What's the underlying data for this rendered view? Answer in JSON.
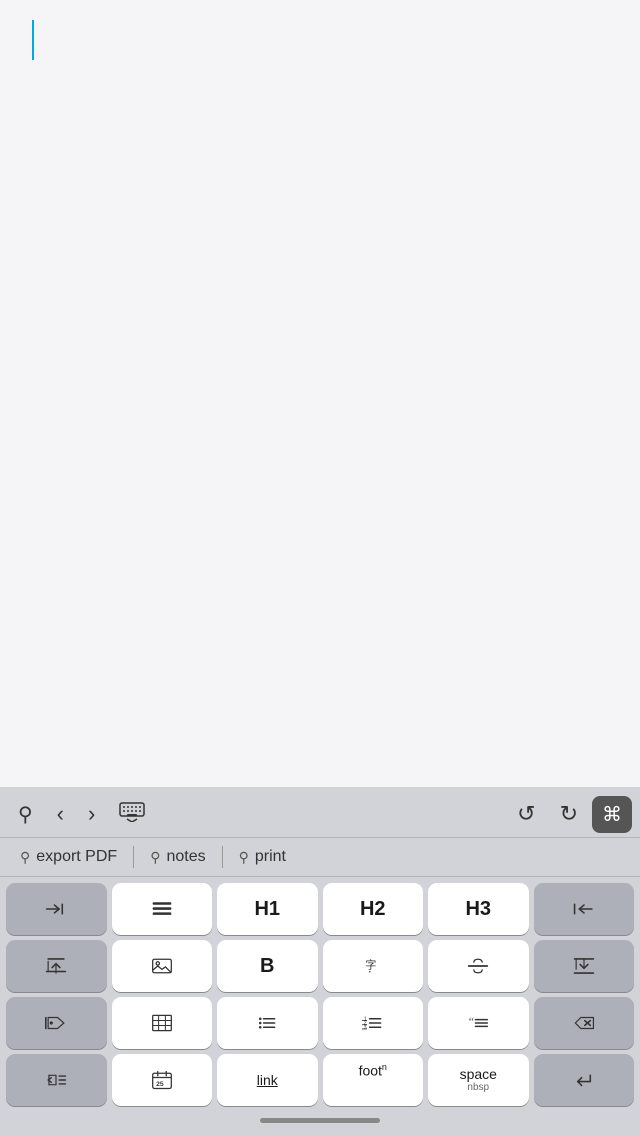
{
  "editor": {
    "background": "#f5f5f7"
  },
  "toolbar": {
    "search_label": "⌕",
    "back_label": "<",
    "forward_label": ">",
    "keyboard_label": "⌨",
    "undo_label": "↺",
    "redo_label": "↻",
    "cmd_label": "⌘"
  },
  "suggestions": [
    {
      "id": "export-pdf",
      "icon": "⌕",
      "label": "export PDF"
    },
    {
      "id": "notes",
      "icon": "⌕",
      "label": "notes"
    },
    {
      "id": "print",
      "icon": "⌕",
      "label": "print"
    }
  ],
  "keys": {
    "row1": [
      {
        "id": "tab",
        "label": "→|",
        "type": "dark",
        "name": "tab-key"
      },
      {
        "id": "align",
        "label": "align",
        "type": "light",
        "name": "align-key"
      },
      {
        "id": "h1",
        "label": "H1",
        "type": "light",
        "name": "h1-key"
      },
      {
        "id": "h2",
        "label": "H2",
        "type": "light",
        "name": "h2-key"
      },
      {
        "id": "h3",
        "label": "H3",
        "type": "light",
        "name": "h3-key"
      },
      {
        "id": "indent-left",
        "label": "|←",
        "type": "dark",
        "name": "indent-left-key"
      }
    ],
    "row2": [
      {
        "id": "move-up",
        "label": "move-up",
        "type": "dark",
        "name": "move-up-key"
      },
      {
        "id": "image",
        "label": "image",
        "type": "light",
        "name": "image-key"
      },
      {
        "id": "bold",
        "label": "B",
        "type": "light",
        "name": "bold-key"
      },
      {
        "id": "ruby",
        "label": "ruby",
        "type": "light",
        "name": "ruby-key"
      },
      {
        "id": "strikethrough",
        "label": "S̶",
        "type": "light",
        "name": "strikethrough-key"
      },
      {
        "id": "move-down",
        "label": "move-down",
        "type": "dark",
        "name": "move-down-key"
      }
    ],
    "row3": [
      {
        "id": "tag",
        "label": "tag",
        "type": "dark",
        "name": "tag-key"
      },
      {
        "id": "table",
        "label": "table",
        "type": "light",
        "name": "table-key"
      },
      {
        "id": "bullet-list",
        "label": "bullet-list",
        "type": "light",
        "name": "bullet-list-key"
      },
      {
        "id": "numbered-list",
        "label": "numbered-list",
        "type": "light",
        "name": "numbered-list-key"
      },
      {
        "id": "blockquote",
        "label": "blockquote",
        "type": "light",
        "name": "blockquote-key"
      },
      {
        "id": "backspace",
        "label": "⌫",
        "type": "dark",
        "name": "backspace-key"
      }
    ],
    "row4": [
      {
        "id": "outdent",
        "label": "outdent",
        "type": "dark",
        "name": "outdent-key"
      },
      {
        "id": "calendar",
        "label": "25",
        "type": "light",
        "name": "calendar-key"
      },
      {
        "id": "link",
        "label": "link",
        "type": "light",
        "name": "link-key"
      },
      {
        "id": "footnote",
        "label": "foot",
        "sup": "n",
        "type": "light",
        "name": "footnote-key"
      },
      {
        "id": "space",
        "label": "space",
        "sublabel": "nbsp",
        "type": "light",
        "name": "space-key"
      },
      {
        "id": "enter",
        "label": "↵",
        "type": "dark",
        "name": "enter-key"
      }
    ]
  }
}
